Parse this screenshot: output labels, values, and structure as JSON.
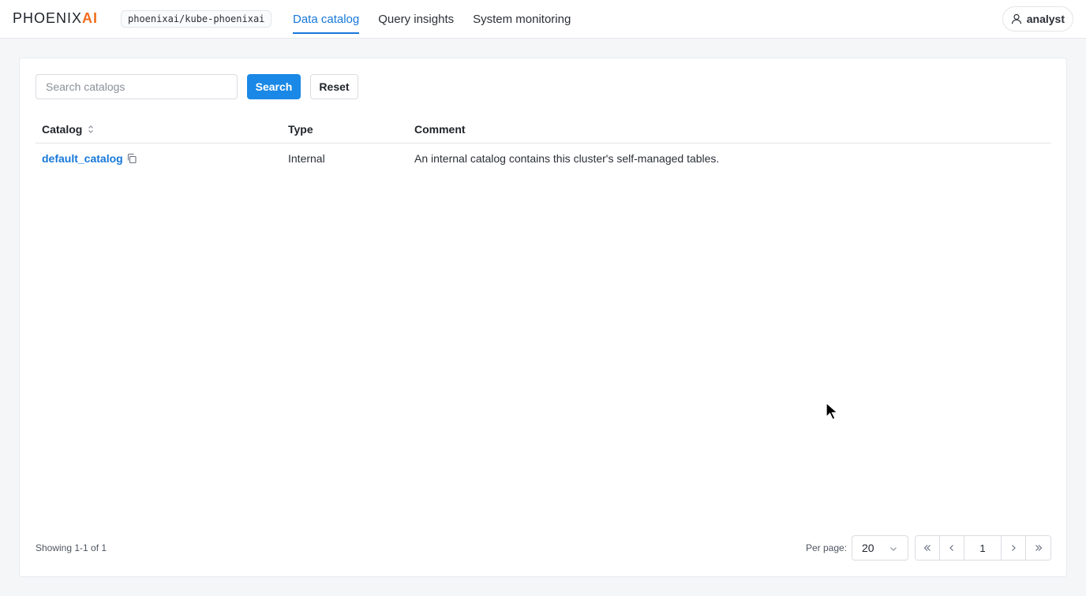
{
  "header": {
    "logo_text_main": "PHOENIX",
    "logo_text_accent": "AI",
    "cluster": "phoenixai/kube-phoenixai",
    "tabs": [
      {
        "label": "Data catalog",
        "active": true
      },
      {
        "label": "Query insights",
        "active": false
      },
      {
        "label": "System monitoring",
        "active": false
      }
    ],
    "user": "analyst"
  },
  "search": {
    "placeholder": "Search catalogs",
    "value": "",
    "search_label": "Search",
    "reset_label": "Reset"
  },
  "table": {
    "columns": [
      "Catalog",
      "Type",
      "Comment"
    ],
    "rows": [
      {
        "catalog": "default_catalog",
        "type": "Internal",
        "comment": "An internal catalog contains this cluster's self-managed tables."
      }
    ]
  },
  "footer": {
    "showing": "Showing 1-1 of 1",
    "per_page_label": "Per page:",
    "per_page_value": "20",
    "current_page": "1"
  },
  "colors": {
    "accent": "#1677d9",
    "brand": "#f26b1d"
  }
}
